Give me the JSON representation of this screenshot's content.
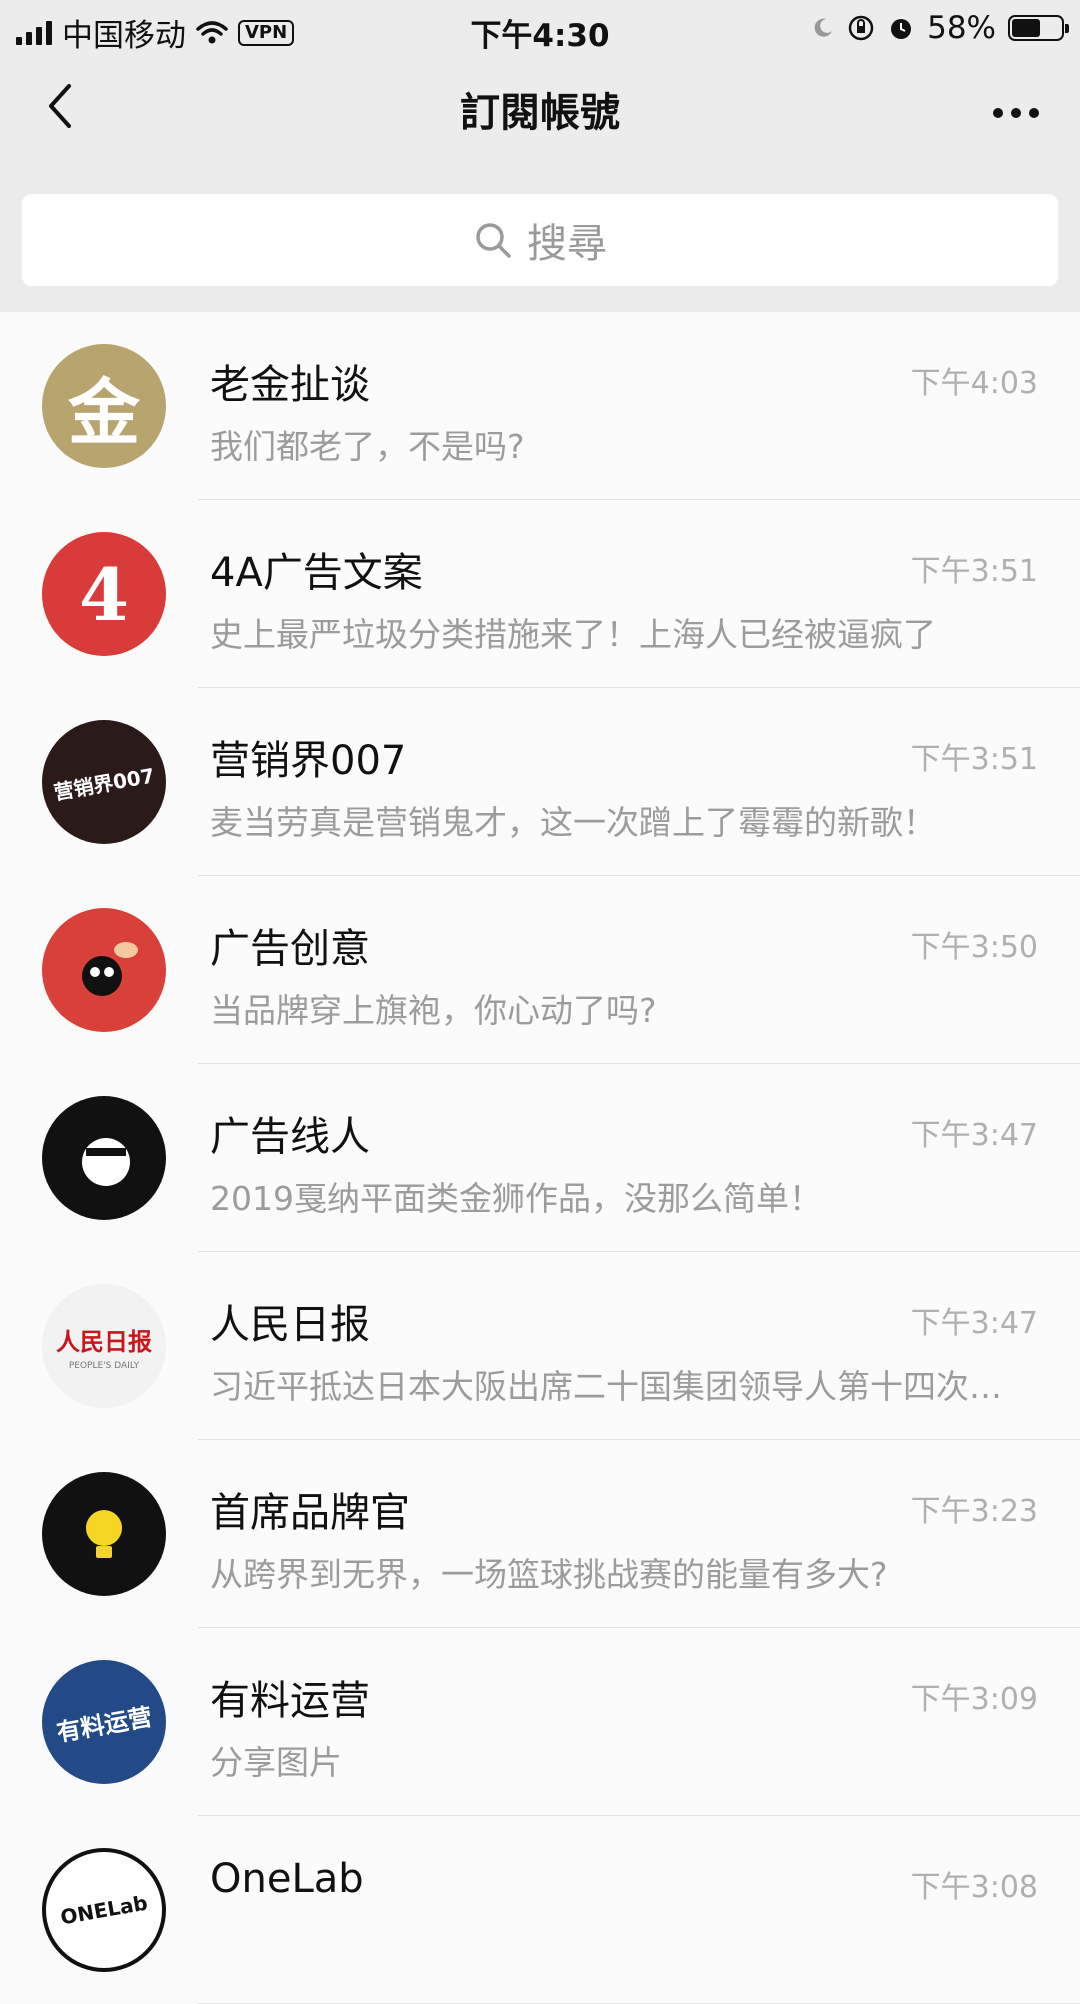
{
  "status": {
    "carrier": "中国移动",
    "vpn": "VPN",
    "time": "下午4:30",
    "battery": "58%",
    "battery_level": 0.58
  },
  "nav": {
    "title": "訂閱帳號"
  },
  "search": {
    "placeholder": "搜尋"
  },
  "items": [
    {
      "name": "老金扯谈",
      "time": "下午4:03",
      "preview": "我们都老了，不是吗?",
      "avatar_text": "金",
      "avatar_bg": "#b8a46e",
      "avatar_fg": "#ffffff"
    },
    {
      "name": "4A广告文案",
      "time": "下午3:51",
      "preview": "史上最严垃圾分类措施来了！上海人已经被逼疯了",
      "avatar_text": "4",
      "avatar_bg": "#d93a3a",
      "avatar_fg": "#ffffff"
    },
    {
      "name": "营销界007",
      "time": "下午3:51",
      "preview": "麦当劳真是营销鬼才，这一次蹭上了霉霉的新歌！",
      "avatar_text": "营销界007",
      "avatar_bg": "#2a1a1a",
      "avatar_fg": "#ffffff"
    },
    {
      "name": "广告创意",
      "time": "下午3:50",
      "preview": "当品牌穿上旗袍，你心动了吗?",
      "avatar_text": "",
      "avatar_bg": "#d9403a",
      "avatar_fg": "#111111"
    },
    {
      "name": "广告线人",
      "time": "下午3:47",
      "preview": "2019戛纳平面类金狮作品，没那么简单！",
      "avatar_text": "",
      "avatar_bg": "#111111",
      "avatar_fg": "#ffffff"
    },
    {
      "name": "人民日报",
      "time": "下午3:47",
      "preview": "习近平抵达日本大阪出席二十国集团领导人第十四次峰会",
      "avatar_text": "人民日报",
      "avatar_sub": "PEOPLE'S DAILY",
      "avatar_bg": "#f2f2f2",
      "avatar_fg": "#c8161d"
    },
    {
      "name": "首席品牌官",
      "time": "下午3:23",
      "preview": "从跨界到无界，一场篮球挑战赛的能量有多大?",
      "avatar_text": "",
      "avatar_bg": "#111111",
      "avatar_fg": "#f5d624"
    },
    {
      "name": "有料运营",
      "time": "下午3:09",
      "preview": "分享图片",
      "avatar_text": "有料运营",
      "avatar_bg": "#234a86",
      "avatar_fg": "#ffffff"
    },
    {
      "name": "OneLab",
      "time": "下午3:08",
      "preview": "",
      "avatar_text": "ONELab",
      "avatar_bg": "#ffffff",
      "avatar_fg": "#111111"
    }
  ]
}
